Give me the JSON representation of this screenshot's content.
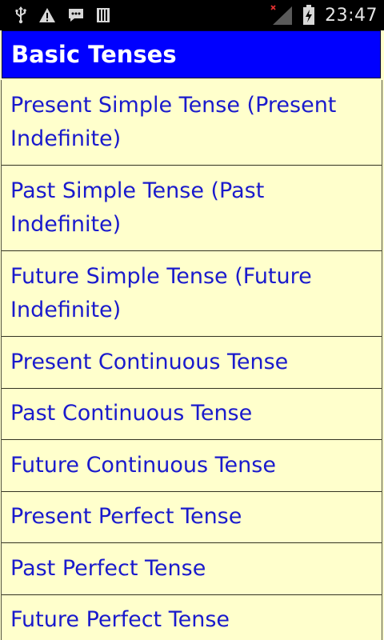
{
  "status_bar": {
    "time": "23:47",
    "left_icons": [
      "usb-icon",
      "warning-icon",
      "chat-icon",
      "sd-card-icon"
    ],
    "right_icons": [
      "signal-icon",
      "battery-charging-icon"
    ]
  },
  "header": {
    "title": "Basic Tenses"
  },
  "colors": {
    "header_bg": "#0000ff",
    "list_bg": "#ffffcc",
    "item_text": "#1a1acc",
    "status_bg": "#000000"
  },
  "items": [
    {
      "label": "Present Simple Tense (Present Indefinite)"
    },
    {
      "label": "Past Simple Tense (Past Indefinite)"
    },
    {
      "label": "Future Simple Tense (Future Indefinite)"
    },
    {
      "label": "Present Continuous Tense"
    },
    {
      "label": "Past Continuous Tense"
    },
    {
      "label": "Future Continuous Tense"
    },
    {
      "label": "Present Perfect Tense"
    },
    {
      "label": "Past Perfect Tense"
    },
    {
      "label": "Future Perfect Tense"
    }
  ]
}
